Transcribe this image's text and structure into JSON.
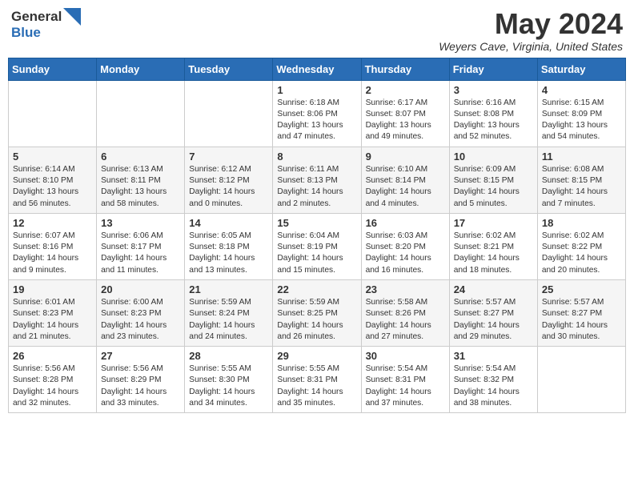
{
  "header": {
    "logo_line1": "General",
    "logo_line2": "Blue",
    "month_year": "May 2024",
    "location": "Weyers Cave, Virginia, United States"
  },
  "weekdays": [
    "Sunday",
    "Monday",
    "Tuesday",
    "Wednesday",
    "Thursday",
    "Friday",
    "Saturday"
  ],
  "weeks": [
    [
      {
        "day": "",
        "sunrise": "",
        "sunset": "",
        "daylight": ""
      },
      {
        "day": "",
        "sunrise": "",
        "sunset": "",
        "daylight": ""
      },
      {
        "day": "",
        "sunrise": "",
        "sunset": "",
        "daylight": ""
      },
      {
        "day": "1",
        "sunrise": "Sunrise: 6:18 AM",
        "sunset": "Sunset: 8:06 PM",
        "daylight": "Daylight: 13 hours and 47 minutes."
      },
      {
        "day": "2",
        "sunrise": "Sunrise: 6:17 AM",
        "sunset": "Sunset: 8:07 PM",
        "daylight": "Daylight: 13 hours and 49 minutes."
      },
      {
        "day": "3",
        "sunrise": "Sunrise: 6:16 AM",
        "sunset": "Sunset: 8:08 PM",
        "daylight": "Daylight: 13 hours and 52 minutes."
      },
      {
        "day": "4",
        "sunrise": "Sunrise: 6:15 AM",
        "sunset": "Sunset: 8:09 PM",
        "daylight": "Daylight: 13 hours and 54 minutes."
      }
    ],
    [
      {
        "day": "5",
        "sunrise": "Sunrise: 6:14 AM",
        "sunset": "Sunset: 8:10 PM",
        "daylight": "Daylight: 13 hours and 56 minutes."
      },
      {
        "day": "6",
        "sunrise": "Sunrise: 6:13 AM",
        "sunset": "Sunset: 8:11 PM",
        "daylight": "Daylight: 13 hours and 58 minutes."
      },
      {
        "day": "7",
        "sunrise": "Sunrise: 6:12 AM",
        "sunset": "Sunset: 8:12 PM",
        "daylight": "Daylight: 14 hours and 0 minutes."
      },
      {
        "day": "8",
        "sunrise": "Sunrise: 6:11 AM",
        "sunset": "Sunset: 8:13 PM",
        "daylight": "Daylight: 14 hours and 2 minutes."
      },
      {
        "day": "9",
        "sunrise": "Sunrise: 6:10 AM",
        "sunset": "Sunset: 8:14 PM",
        "daylight": "Daylight: 14 hours and 4 minutes."
      },
      {
        "day": "10",
        "sunrise": "Sunrise: 6:09 AM",
        "sunset": "Sunset: 8:15 PM",
        "daylight": "Daylight: 14 hours and 5 minutes."
      },
      {
        "day": "11",
        "sunrise": "Sunrise: 6:08 AM",
        "sunset": "Sunset: 8:15 PM",
        "daylight": "Daylight: 14 hours and 7 minutes."
      }
    ],
    [
      {
        "day": "12",
        "sunrise": "Sunrise: 6:07 AM",
        "sunset": "Sunset: 8:16 PM",
        "daylight": "Daylight: 14 hours and 9 minutes."
      },
      {
        "day": "13",
        "sunrise": "Sunrise: 6:06 AM",
        "sunset": "Sunset: 8:17 PM",
        "daylight": "Daylight: 14 hours and 11 minutes."
      },
      {
        "day": "14",
        "sunrise": "Sunrise: 6:05 AM",
        "sunset": "Sunset: 8:18 PM",
        "daylight": "Daylight: 14 hours and 13 minutes."
      },
      {
        "day": "15",
        "sunrise": "Sunrise: 6:04 AM",
        "sunset": "Sunset: 8:19 PM",
        "daylight": "Daylight: 14 hours and 15 minutes."
      },
      {
        "day": "16",
        "sunrise": "Sunrise: 6:03 AM",
        "sunset": "Sunset: 8:20 PM",
        "daylight": "Daylight: 14 hours and 16 minutes."
      },
      {
        "day": "17",
        "sunrise": "Sunrise: 6:02 AM",
        "sunset": "Sunset: 8:21 PM",
        "daylight": "Daylight: 14 hours and 18 minutes."
      },
      {
        "day": "18",
        "sunrise": "Sunrise: 6:02 AM",
        "sunset": "Sunset: 8:22 PM",
        "daylight": "Daylight: 14 hours and 20 minutes."
      }
    ],
    [
      {
        "day": "19",
        "sunrise": "Sunrise: 6:01 AM",
        "sunset": "Sunset: 8:23 PM",
        "daylight": "Daylight: 14 hours and 21 minutes."
      },
      {
        "day": "20",
        "sunrise": "Sunrise: 6:00 AM",
        "sunset": "Sunset: 8:23 PM",
        "daylight": "Daylight: 14 hours and 23 minutes."
      },
      {
        "day": "21",
        "sunrise": "Sunrise: 5:59 AM",
        "sunset": "Sunset: 8:24 PM",
        "daylight": "Daylight: 14 hours and 24 minutes."
      },
      {
        "day": "22",
        "sunrise": "Sunrise: 5:59 AM",
        "sunset": "Sunset: 8:25 PM",
        "daylight": "Daylight: 14 hours and 26 minutes."
      },
      {
        "day": "23",
        "sunrise": "Sunrise: 5:58 AM",
        "sunset": "Sunset: 8:26 PM",
        "daylight": "Daylight: 14 hours and 27 minutes."
      },
      {
        "day": "24",
        "sunrise": "Sunrise: 5:57 AM",
        "sunset": "Sunset: 8:27 PM",
        "daylight": "Daylight: 14 hours and 29 minutes."
      },
      {
        "day": "25",
        "sunrise": "Sunrise: 5:57 AM",
        "sunset": "Sunset: 8:27 PM",
        "daylight": "Daylight: 14 hours and 30 minutes."
      }
    ],
    [
      {
        "day": "26",
        "sunrise": "Sunrise: 5:56 AM",
        "sunset": "Sunset: 8:28 PM",
        "daylight": "Daylight: 14 hours and 32 minutes."
      },
      {
        "day": "27",
        "sunrise": "Sunrise: 5:56 AM",
        "sunset": "Sunset: 8:29 PM",
        "daylight": "Daylight: 14 hours and 33 minutes."
      },
      {
        "day": "28",
        "sunrise": "Sunrise: 5:55 AM",
        "sunset": "Sunset: 8:30 PM",
        "daylight": "Daylight: 14 hours and 34 minutes."
      },
      {
        "day": "29",
        "sunrise": "Sunrise: 5:55 AM",
        "sunset": "Sunset: 8:31 PM",
        "daylight": "Daylight: 14 hours and 35 minutes."
      },
      {
        "day": "30",
        "sunrise": "Sunrise: 5:54 AM",
        "sunset": "Sunset: 8:31 PM",
        "daylight": "Daylight: 14 hours and 37 minutes."
      },
      {
        "day": "31",
        "sunrise": "Sunrise: 5:54 AM",
        "sunset": "Sunset: 8:32 PM",
        "daylight": "Daylight: 14 hours and 38 minutes."
      },
      {
        "day": "",
        "sunrise": "",
        "sunset": "",
        "daylight": ""
      }
    ]
  ]
}
